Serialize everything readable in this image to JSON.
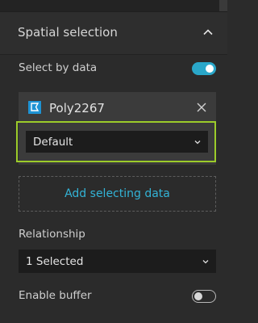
{
  "panel": {
    "title": "Spatial selection"
  },
  "select_by_data": {
    "label": "Select by data",
    "enabled": true
  },
  "data_source": {
    "name": "Poly2267",
    "icon": "polygon-layer-icon",
    "icon_color": "#1e93d4",
    "filter_value": "Default"
  },
  "add_button": {
    "label": "Add selecting data",
    "color": "#33b3d6"
  },
  "relationship": {
    "label": "Relationship",
    "value": "1 Selected"
  },
  "buffer": {
    "label": "Enable buffer",
    "enabled": false
  },
  "colors": {
    "accent": "#2aa7c9",
    "highlight": "#9ccc2a",
    "background": "#2b2b2b"
  }
}
